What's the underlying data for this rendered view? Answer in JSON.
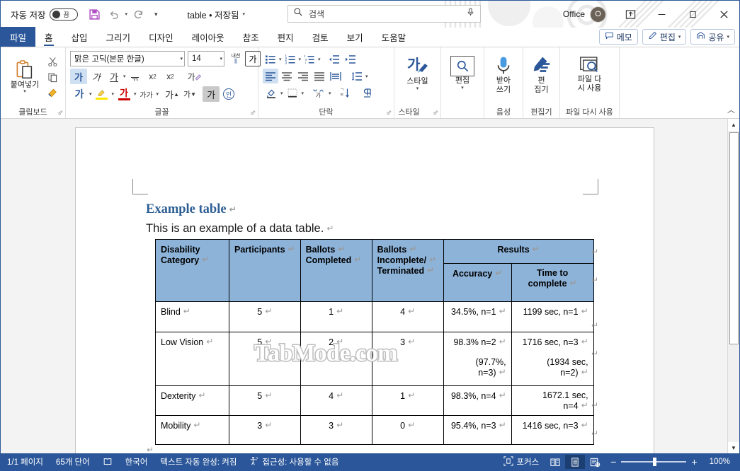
{
  "titlebar": {
    "autosave_label": "자동 저장",
    "autosave_state": "끔",
    "save_icon": "save-icon",
    "undo_icon": "undo-icon",
    "redo_icon": "redo-icon",
    "customize_qat_icon": "chevron-down-icon",
    "document_title": "table • 저장됨",
    "title_chevron": "chevron-down-icon",
    "search_placeholder": "검색",
    "search_icon": "search-icon",
    "mic_icon": "microphone-icon",
    "account_label": "Office",
    "avatar_initial": "O",
    "ribbon_display_icon": "ribbon-display-options-icon",
    "minimize_icon": "minimize-icon",
    "restore_icon": "restore-icon",
    "close_icon": "close-icon"
  },
  "tabs": {
    "file": "파일",
    "items": [
      {
        "label": "홈",
        "active": true
      },
      {
        "label": "삽입",
        "active": false
      },
      {
        "label": "그리기",
        "active": false
      },
      {
        "label": "디자인",
        "active": false
      },
      {
        "label": "레이아웃",
        "active": false
      },
      {
        "label": "참조",
        "active": false
      },
      {
        "label": "편지",
        "active": false
      },
      {
        "label": "검토",
        "active": false
      },
      {
        "label": "보기",
        "active": false
      },
      {
        "label": "도움말",
        "active": false
      }
    ],
    "right_buttons": [
      {
        "label": "메모",
        "icon": "comment-icon",
        "caret": false
      },
      {
        "label": "편집",
        "icon": "pencil-icon",
        "caret": true
      },
      {
        "label": "공유",
        "icon": "share-icon",
        "caret": true
      }
    ]
  },
  "ribbon": {
    "collapse_icon": "chevron-up-icon",
    "groups": [
      {
        "name": "클립보드",
        "launcher": true
      },
      {
        "name": "글꼴",
        "launcher": true
      },
      {
        "name": "단락",
        "launcher": true
      },
      {
        "name": "스타일",
        "launcher": true
      },
      {
        "name": "음성",
        "launcher": false
      },
      {
        "name": "편집기",
        "launcher": false
      },
      {
        "name": "파일 다시 사용",
        "launcher": false
      }
    ],
    "clipboard": {
      "paste_label": "붙여넣기",
      "paste_icon": "paste-icon",
      "cut_icon": "scissors-icon",
      "copy_icon": "copy-icon",
      "format_painter_icon": "format-painter-icon"
    },
    "font": {
      "font_name": "맑은 고딕(본문 한글)",
      "font_size": "14",
      "phonetic_guide_label": "내천",
      "char_border_label": "가",
      "bold_label": "가",
      "italic_label": "가",
      "underline_label": "가",
      "strikethrough_label": "ᆩ",
      "subscript_label": "x",
      "superscript_label": "x",
      "clear_format_label": "가",
      "text_effects_label": "가",
      "highlight_label": "펜",
      "font_color_label": "가",
      "char_shading_label": "가가",
      "grow_font_label": "가",
      "shrink_font_label": "가",
      "change_case_label": "가",
      "enclose_char_label": "인"
    },
    "paragraph": {
      "bullets_icon": "bullet-list-icon",
      "numbering_icon": "numbered-list-icon",
      "multilevel_icon": "multilevel-list-icon",
      "decrease_indent_icon": "decrease-indent-icon",
      "increase_indent_icon": "increase-indent-icon",
      "align_left_icon": "align-left-icon",
      "align_center_icon": "align-center-icon",
      "align_right_icon": "align-right-icon",
      "justify_icon": "justify-icon",
      "distribute_icon": "distribute-icon",
      "line_spacing_icon": "line-spacing-icon",
      "shading_icon": "shading-icon",
      "borders_icon": "borders-icon",
      "asian_layout_icon": "asian-layout-icon",
      "sort_icon": "sort-icon",
      "show_marks_icon": "show-formatting-marks-icon"
    },
    "styles": {
      "label": "스타일",
      "icon": "styles-icon",
      "caret": "chevron-down-icon"
    },
    "editing": {
      "label": "편집",
      "icon": "search-icon",
      "caret": "chevron-down-icon"
    },
    "dictate": {
      "label": "받아\n쓰기",
      "line1": "받아",
      "line2": "쓰기",
      "icon": "microphone-icon"
    },
    "editor": {
      "line1": "편",
      "line2": "집기",
      "icon": "editor-pen-icon"
    },
    "reuse": {
      "line1": "파일 다",
      "line2": "시 사용",
      "icon": "reuse-files-icon"
    }
  },
  "document": {
    "heading": "Example table",
    "paragraph": "This is an example of a data table.",
    "watermark": "TabMode.com",
    "table": {
      "header_group": "Results",
      "headers": [
        "Disability Category",
        "Participants",
        "Ballots Completed",
        "Ballots Incomplete/ Terminated"
      ],
      "headers_lines": [
        [
          "Disability",
          "Category"
        ],
        [
          "Participants"
        ],
        [
          "Ballots",
          "Completed"
        ],
        [
          "Ballots",
          "Incomplete/",
          "Terminated"
        ]
      ],
      "subheaders": [
        "Accuracy",
        "Time to complete"
      ],
      "subheaders_lines": [
        [
          "Accuracy"
        ],
        [
          "Time to",
          "complete"
        ]
      ],
      "rows": [
        {
          "category": "Blind",
          "participants": "5",
          "completed": "1",
          "incomplete": "4",
          "accuracy": "34.5%, n=1",
          "accuracy2": "",
          "time": "1199 sec, n=1",
          "time2": ""
        },
        {
          "category": "Low Vision",
          "participants": "5",
          "completed": "2",
          "incomplete": "3",
          "accuracy": "98.3% n=2",
          "accuracy2": "(97.7%, n=3)",
          "time": "1716 sec, n=3",
          "time2": "(1934 sec, n=2)"
        },
        {
          "category": "Dexterity",
          "participants": "5",
          "completed": "4",
          "incomplete": "1",
          "accuracy": "98.3%, n=4",
          "accuracy2": "",
          "time": "1672.1 sec, n=4",
          "time2": ""
        },
        {
          "category": "Mobility",
          "participants": "3",
          "completed": "3",
          "incomplete": "0",
          "accuracy": "95.4%, n=3",
          "accuracy2": "",
          "time": "1416 sec, n=3",
          "time2": ""
        }
      ]
    }
  },
  "statusbar": {
    "page": "1/1 페이지",
    "words": "65개 단어",
    "proofing_icon": "proofing-icon",
    "language": "한국어",
    "autocomplete": "텍스트 자동 완성: 켜짐",
    "accessibility_icon": "accessibility-icon",
    "accessibility": "접근성: 사용할 수 없음",
    "focus_icon": "focus-icon",
    "focus": "포커스",
    "read_mode_icon": "read-mode-icon",
    "print_layout_icon": "print-layout-icon",
    "web_layout_icon": "web-layout-icon",
    "zoom_out": "−",
    "zoom_in": "+",
    "zoom_level": "100%"
  },
  "colors": {
    "accent": "#2b579a",
    "table_header": "#8db3d9",
    "heading": "#2e5f94",
    "page_bg": "#f3f3f3"
  }
}
